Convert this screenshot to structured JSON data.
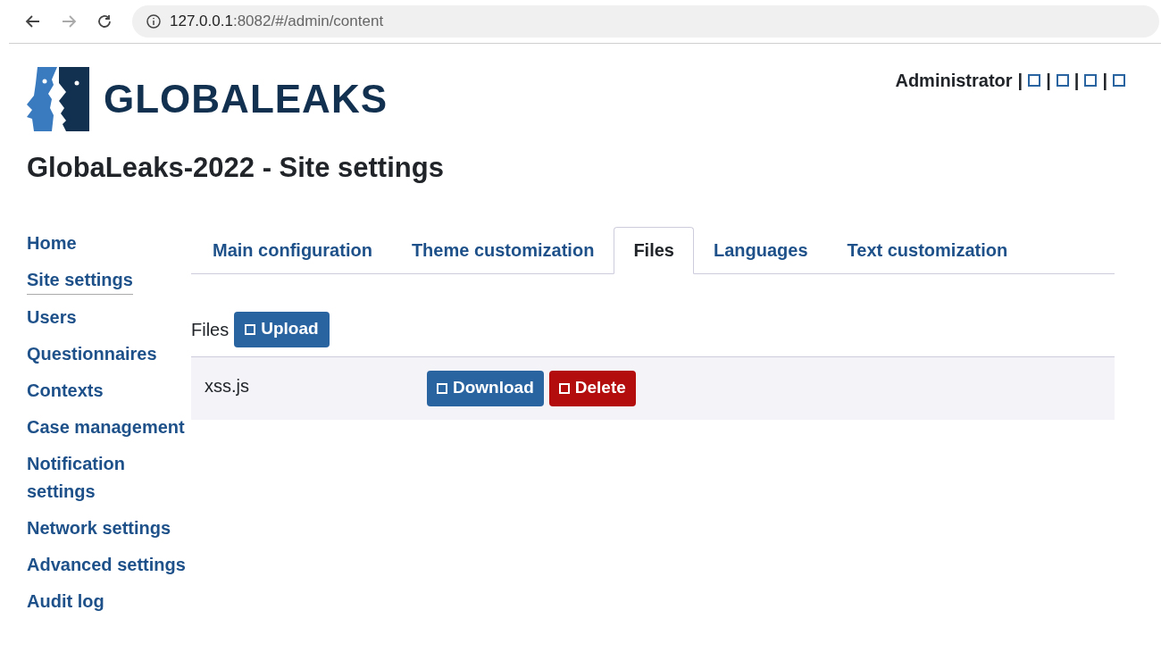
{
  "browser": {
    "url_host": "127.0.0.1",
    "url_rest": ":8082/#/admin/content"
  },
  "logo": {
    "text": "GLOBALEAKS"
  },
  "header": {
    "user": "Administrator",
    "links": [
      {
        "separator": "|"
      },
      {
        "separator": "|"
      },
      {
        "separator": "|"
      },
      {
        "separator": "|"
      }
    ]
  },
  "page_title": "GlobaLeaks-2022 - Site settings",
  "sidebar": {
    "items": [
      {
        "label": "Home",
        "selected": false
      },
      {
        "label": "Site settings",
        "selected": true
      },
      {
        "label": "Users",
        "selected": false
      },
      {
        "label": "Questionnaires",
        "selected": false
      },
      {
        "label": "Contexts",
        "selected": false
      },
      {
        "label": "Case management",
        "selected": false
      },
      {
        "label": "Notification settings",
        "selected": false
      },
      {
        "label": "Network settings",
        "selected": false
      },
      {
        "label": "Advanced settings",
        "selected": false
      },
      {
        "label": "Audit log",
        "selected": false
      }
    ]
  },
  "tabs": [
    {
      "label": "Main configuration",
      "selected": false
    },
    {
      "label": "Theme customization",
      "selected": false
    },
    {
      "label": "Files",
      "selected": true
    },
    {
      "label": "Languages",
      "selected": false
    },
    {
      "label": "Text customization",
      "selected": false
    }
  ],
  "files": {
    "heading": "Files",
    "upload_button": "Upload",
    "rows": [
      {
        "name": "xss.js",
        "buttons": [
          {
            "label": "Download",
            "kind": "primary"
          },
          {
            "label": "Delete",
            "kind": "danger"
          }
        ]
      }
    ]
  }
}
